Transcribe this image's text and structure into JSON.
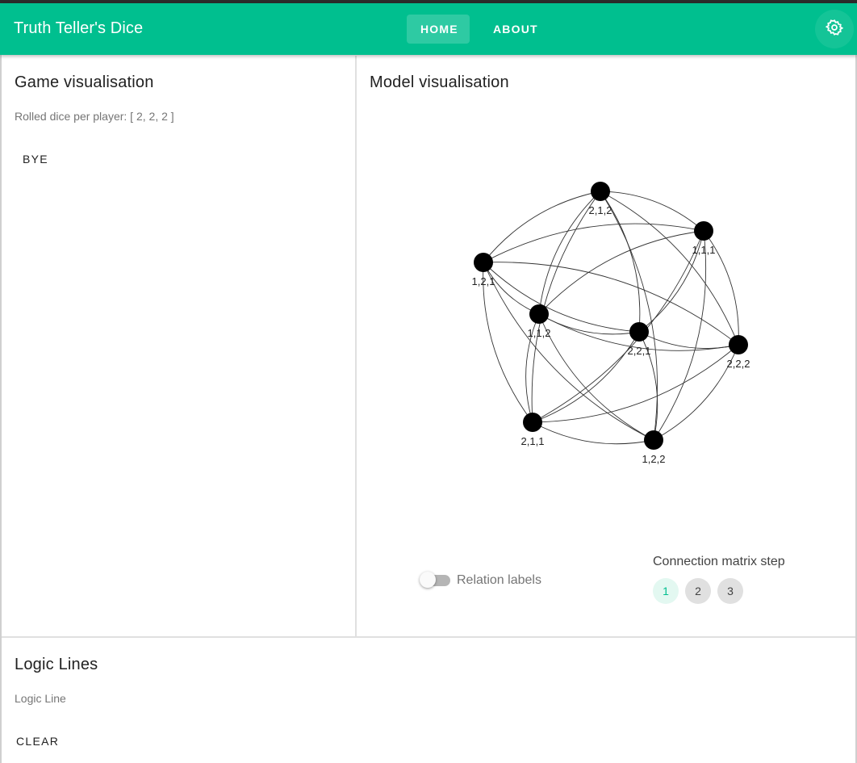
{
  "app": {
    "title": "Truth Teller's Dice"
  },
  "nav": {
    "home": "HOME",
    "about": "ABOUT",
    "settings_icon": "gear-icon"
  },
  "game": {
    "title": "Game visualisation",
    "rolled": "Rolled dice per player: [ 2, 2, 2 ]",
    "bye_button": "BYE"
  },
  "model": {
    "title": "Model visualisation",
    "nodes": [
      "2,1,2",
      "1,1,1",
      "1,2,1",
      "1,1,2",
      "2,2,1",
      "2,2,2",
      "2,1,1",
      "1,2,2"
    ],
    "relation_labels": {
      "label": "Relation labels",
      "enabled": false
    },
    "matrix": {
      "label": "Connection matrix step",
      "steps": [
        "1",
        "2",
        "3"
      ],
      "active": "1"
    }
  },
  "logic": {
    "title": "Logic Lines",
    "line": "Logic Line",
    "clear_button": "CLEAR"
  },
  "colors": {
    "accent": "#00bf8f",
    "node": "#000000",
    "edge": "#333333"
  }
}
